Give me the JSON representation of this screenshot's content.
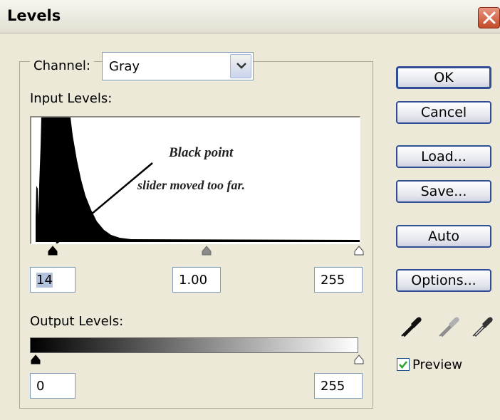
{
  "window": {
    "title": "Levels"
  },
  "channel": {
    "label": "Channel:",
    "value": "Gray"
  },
  "input_levels": {
    "label": "Input Levels:",
    "black": "14",
    "gamma": "1.00",
    "white": "255"
  },
  "annotation": {
    "line1": "Black point",
    "line2": "slider moved too far."
  },
  "output_levels": {
    "label": "Output Levels:",
    "black": "0",
    "white": "255"
  },
  "buttons": {
    "ok": "OK",
    "cancel": "Cancel",
    "load": "Load...",
    "save": "Save...",
    "auto": "Auto",
    "options": "Options..."
  },
  "preview": {
    "label": "Preview",
    "checked": true
  },
  "icons": [
    "close-icon",
    "dropdown-arrow-icon",
    "black-eyedropper-icon",
    "gray-eyedropper-icon",
    "white-eyedropper-icon",
    "checkmark-icon"
  ],
  "colors": {
    "button_border": "#2f4e96",
    "dialog_bg": "#ece9d8",
    "close_button": "#c44a2a",
    "checkbox_check": "#2aa52a"
  },
  "histogram": {
    "shape": "sharp peak at the dark (left) end, falling off by about level 60, nearly empty toward white"
  }
}
